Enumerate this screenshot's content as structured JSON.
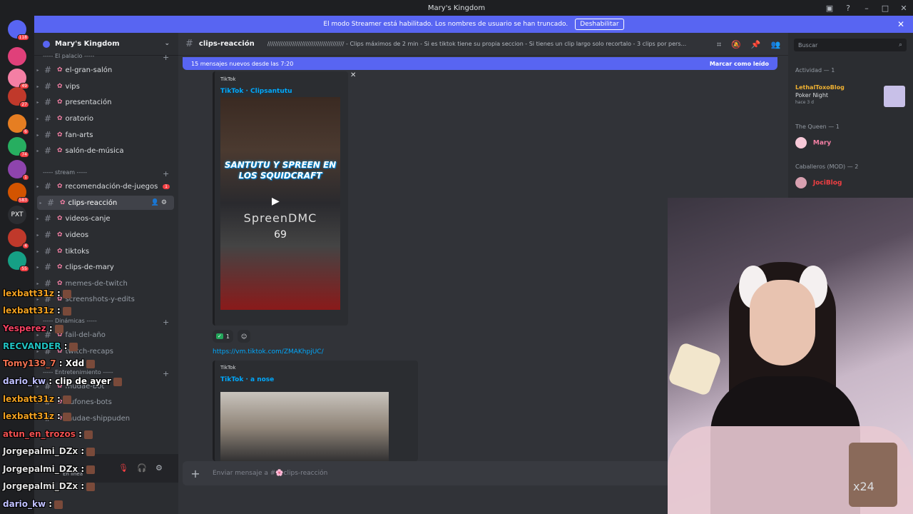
{
  "window": {
    "title": "Mary's Kingdom"
  },
  "banner": {
    "text": "El modo Streamer está habilitado. Los nombres de usuario se han truncado.",
    "button": "Deshabilitar"
  },
  "servers": [
    {
      "label": "",
      "badge": "118",
      "color": "#5865f2"
    },
    {
      "label": "",
      "badge": "",
      "color": "#e0407a"
    },
    {
      "label": "",
      "badge": "49",
      "color": "#f47fa4"
    },
    {
      "label": "",
      "badge": "27",
      "color": "#c0392b"
    },
    {
      "label": "",
      "badge": "6",
      "color": "#e67e22"
    },
    {
      "label": "",
      "badge": "74",
      "color": "#27ae60"
    },
    {
      "label": "",
      "badge": "1",
      "color": "#8e44ad"
    },
    {
      "label": "",
      "badge": "583",
      "color": "#d35400"
    },
    {
      "label": "PXT",
      "badge": "",
      "color": "#2b2d31"
    },
    {
      "label": "",
      "badge": "4",
      "color": "#c0392b"
    },
    {
      "label": "",
      "badge": "55",
      "color": "#16a085"
    }
  ],
  "guild": {
    "name": "Mary's Kingdom"
  },
  "channels": {
    "cat_palace": "----- El palacio -----",
    "cat_stream": "----- stream -----",
    "cat_dyn": "----- Dinámicas -----",
    "cat_ent": "----- Entretenimiento -----",
    "items": [
      {
        "name": "el-gran-salón"
      },
      {
        "name": "vips"
      },
      {
        "name": "presentación"
      },
      {
        "name": "oratorio"
      },
      {
        "name": "fan-arts"
      },
      {
        "name": "salón-de-música"
      },
      {
        "name": "recomendación-de-juegos",
        "badge": "1"
      },
      {
        "name": "clips-reacción"
      },
      {
        "name": "videos-canje"
      },
      {
        "name": "videos"
      },
      {
        "name": "tiktoks"
      },
      {
        "name": "clips-de-mary"
      },
      {
        "name": "memes-de-twitch"
      },
      {
        "name": "screenshots-y-edits"
      },
      {
        "name": "fail-del-año"
      },
      {
        "name": "twitch-recaps"
      },
      {
        "name": "mudae-bot"
      },
      {
        "name": "bufones-bots"
      },
      {
        "name": "mudae-shippuden"
      }
    ]
  },
  "userbar": {
    "status": "En línea"
  },
  "channel_header": {
    "name": "clips-reacción",
    "topic": "//////////////////////////////////////// - Clips máximos de 2 min - Si es tiktok tiene su propia seccion - Si tienes un clip largo solo recortalo - 3 clips por pers..."
  },
  "newbar": {
    "text": "15 mensajes nuevos desde las 7:20",
    "mark": "Marcar como leído"
  },
  "embed1": {
    "provider": "TikTok",
    "title": "TikTok · Clipsantutu",
    "video_text": "SANTUTU Y SPREEN EN LOS SQUIDCRAFT",
    "overlay_big": "SpreenDMC",
    "overlay_num": "69"
  },
  "reactions": {
    "count": "1"
  },
  "link": "https://vm.tiktok.com/ZMAKhpjUC/",
  "embed2": {
    "provider": "TikTok",
    "title": "TikTok · a nose"
  },
  "composer": {
    "placeholder": "Enviar mensaje a #🌸clips-reacción"
  },
  "members": {
    "search": "Buscar",
    "activity": "Actividad — 1",
    "act_user": "LethalToxoBlog",
    "act_game": "Poker Night",
    "act_time": "hace 3 d",
    "role_queen": "The Queen — 1",
    "queen_user": "Mary",
    "role_knights": "Caballeros (MOD) — 2",
    "knight_user": "JociBlog"
  },
  "chat": [
    {
      "user": "lexbatt31z",
      "msg": ":",
      "color": "#f0a020"
    },
    {
      "user": "lexbatt31z",
      "msg": ":",
      "color": "#f0a020"
    },
    {
      "user": "Yesperez",
      "msg": ":",
      "color": "#f04060"
    },
    {
      "user": "RECVANDER",
      "msg": ":",
      "color": "#20c0c0"
    },
    {
      "user": "Tomy139_7",
      "msg": ": Xdd",
      "color": "#f07050"
    },
    {
      "user": "dario_kw",
      "msg": ": clip de ayer",
      "color": "#c0c0ff"
    },
    {
      "user": "lexbatt31z",
      "msg": ":",
      "color": "#f0a020"
    },
    {
      "user": "lexbatt31z",
      "msg": ":",
      "color": "#f0a020"
    },
    {
      "user": "atun_en_trozos",
      "msg": ":",
      "color": "#f05050"
    },
    {
      "user": "Jorgepalmi_DZx",
      "msg": ":",
      "color": "#e0e0e0"
    },
    {
      "user": "Jorgepalmi_DZx",
      "msg": ":",
      "color": "#e0e0e0"
    },
    {
      "user": "Jorgepalmi_DZx",
      "msg": ":",
      "color": "#e0e0e0"
    },
    {
      "user": "dario_kw",
      "msg": ":",
      "color": "#c0c0ff"
    }
  ],
  "overlay": {
    "emote_text": "x24"
  }
}
